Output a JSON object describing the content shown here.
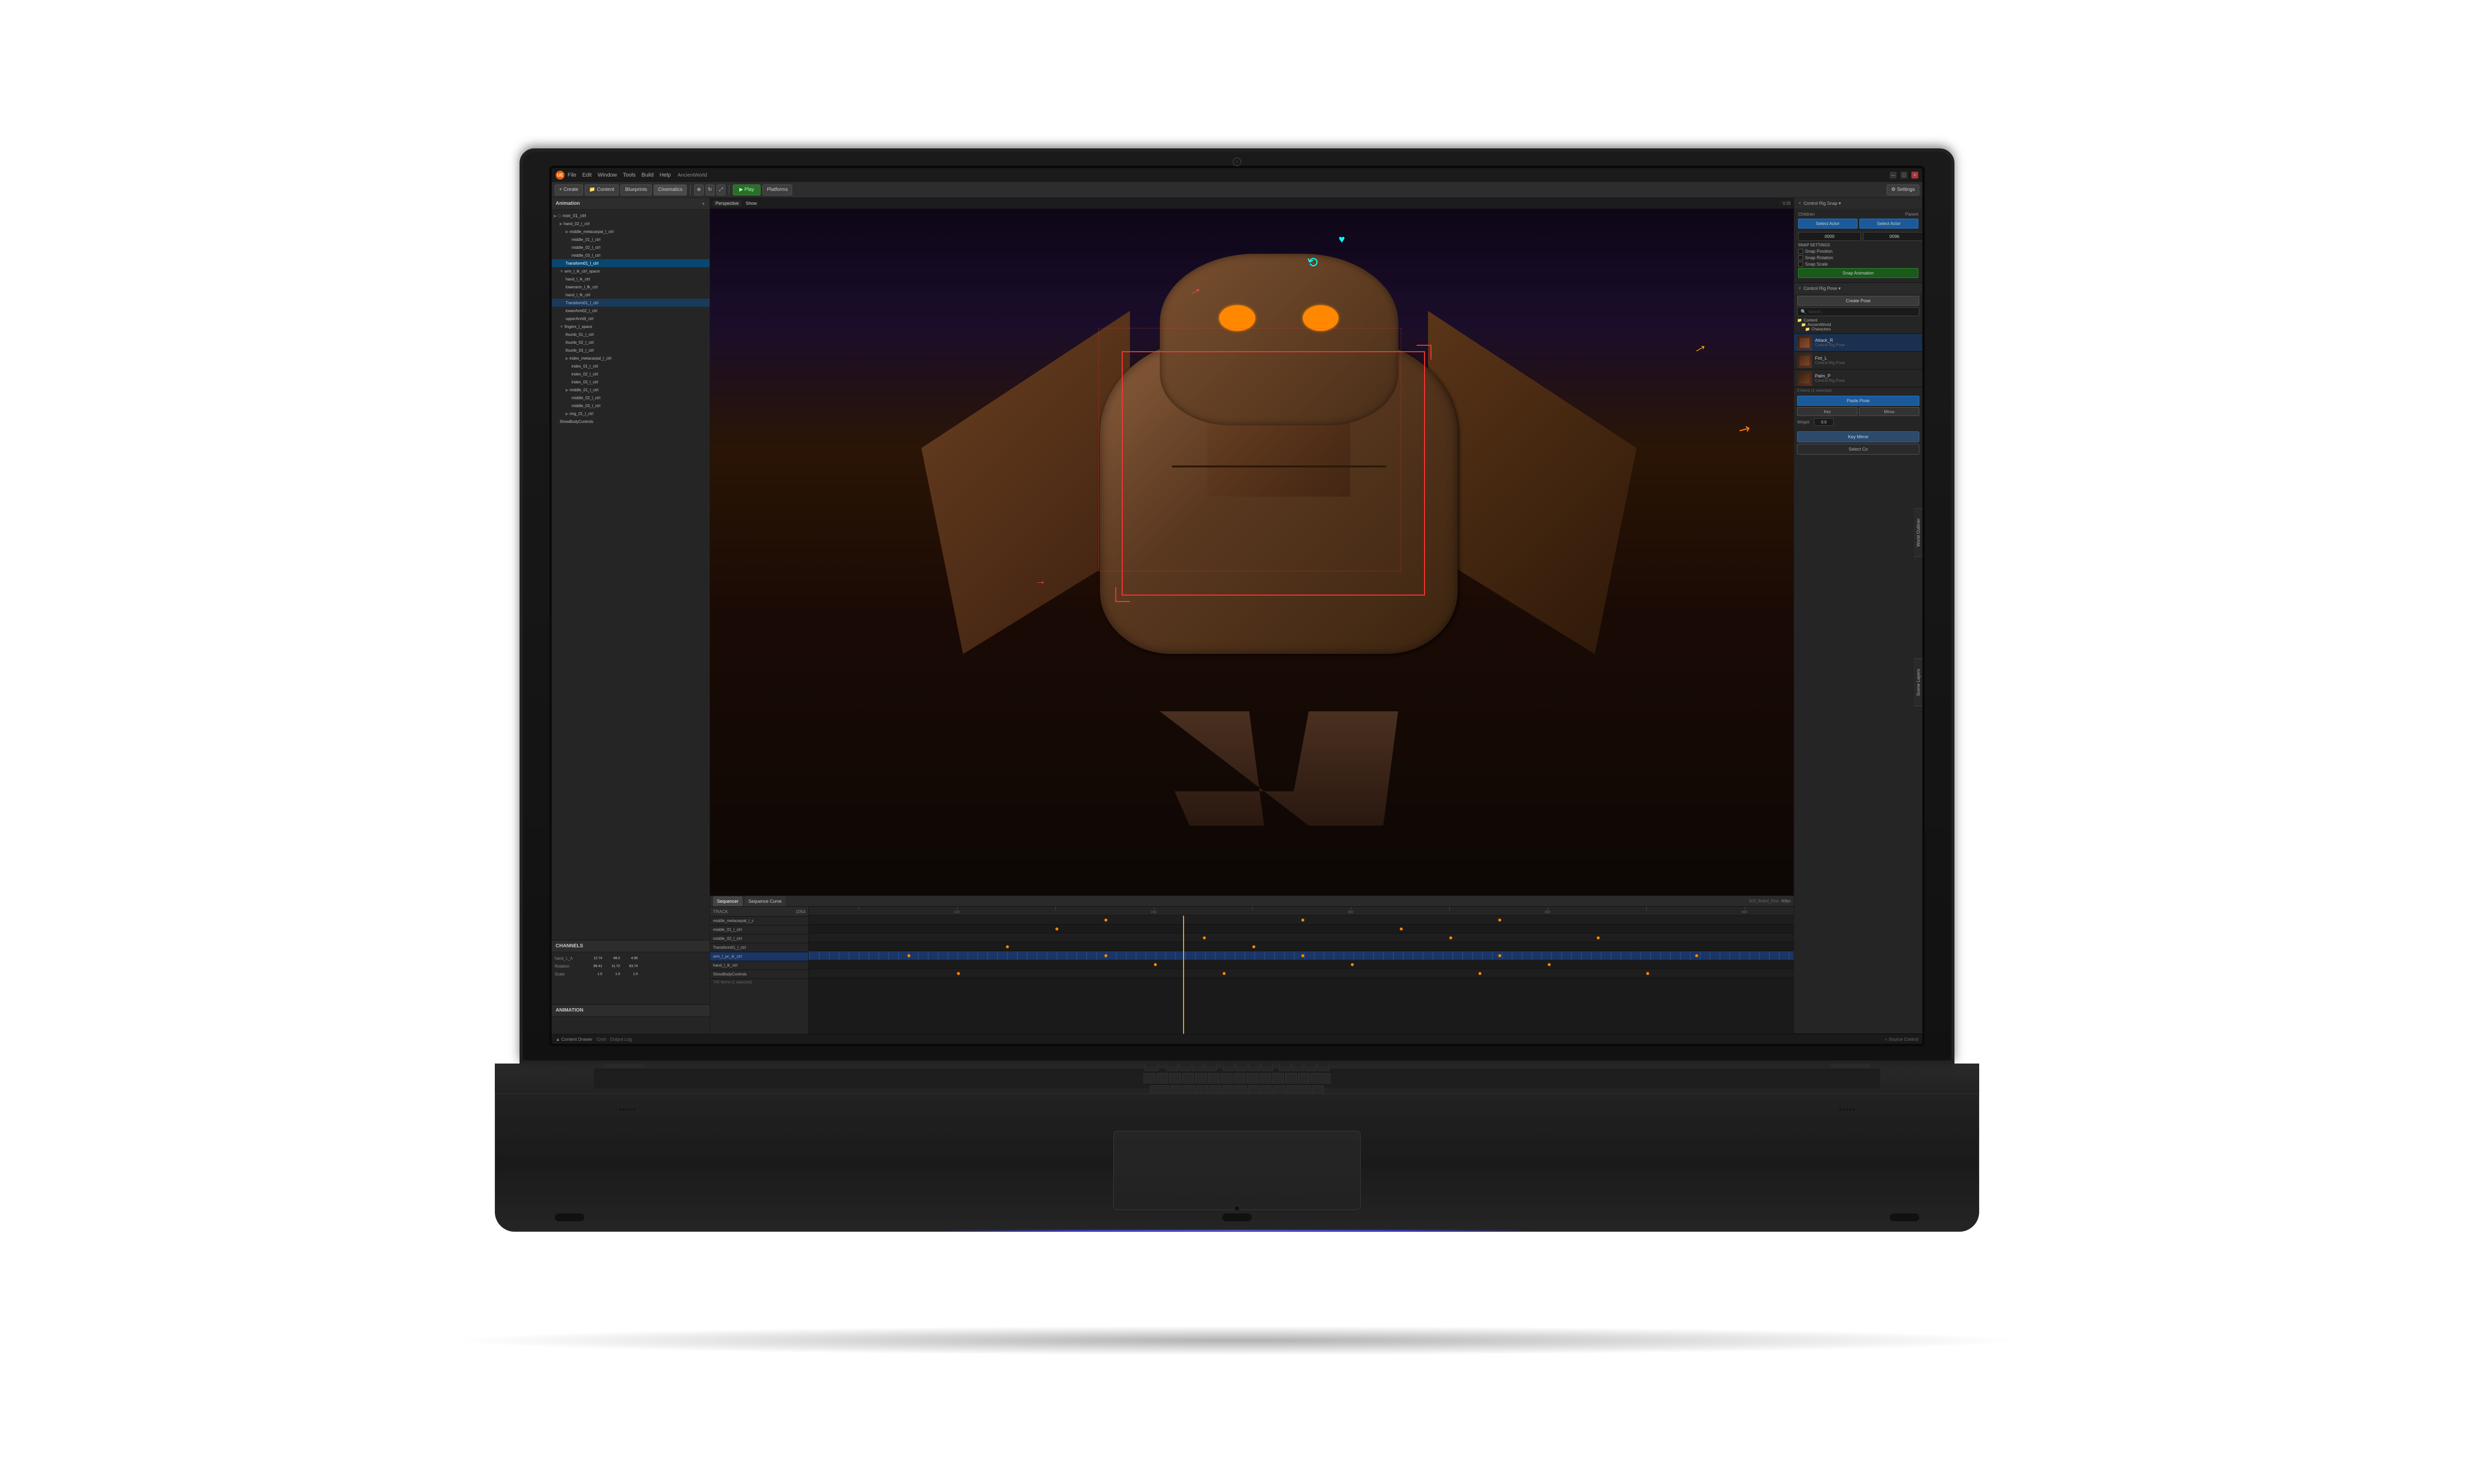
{
  "window": {
    "title": "AncientWorld",
    "logo": "UE",
    "menu": [
      "File",
      "Edit",
      "Window",
      "Tools",
      "Build",
      "Help"
    ],
    "controls": [
      "—",
      "□",
      "✕"
    ]
  },
  "toolbar": {
    "create": "Create",
    "content": "Content",
    "blueprints": "Blueprints",
    "cinematics": "Cinematics",
    "play": "▶ Play",
    "platforms": "Platforms",
    "settings": "⚙ Settings"
  },
  "viewport": {
    "mode": "Perspective",
    "view": "Show",
    "world_label": "World",
    "camera_speed": "0.25"
  },
  "outliner": {
    "title": "Animation",
    "items": [
      "root_01_ctrl",
      "hand_02_l_ctrl",
      "middle_metacarpal_l_ctrl",
      "middle_01_l_ctrl",
      "middle_02_l_ctrl",
      "middle_03_l_ctrl",
      "Transform01_l_ctrl",
      "arm_l_ik_ctrl_space",
      "hand_l_ik_ctrl",
      "lowerarm_l_fk_ctrl",
      "hand_l_fk_ctrl",
      "Transform01_l_ctrl",
      "lowerArm02_l_ctrl",
      "upperArm0l_ctrl",
      "fingers_l_space",
      "thumb_01_l_ctrl",
      "thumb_02_l_ctrl",
      "thumb_03_l_ctrl",
      "index_metacarpal_l_ctrl",
      "index_01_l_ctrl",
      "index_02_l_ctrl",
      "index_03_l_ctrl",
      "middle_01_l_ctrl",
      "middle_02_l_ctrl",
      "middle_03_l_ctrl",
      "ring_01_l_ctrl",
      "ShowBodyControls"
    ]
  },
  "channels": {
    "title": "CHANNELS",
    "items": [
      {
        "name": "hand_L_A",
        "val1": "12.74",
        "val2": "48.0",
        "val3": "4.95"
      },
      {
        "name": "Rotation",
        "val1": "89.41",
        "val2": "11.72",
        "val3": "63.74"
      },
      {
        "name": "Scale",
        "val1": "1.0",
        "val2": "1.0",
        "val3": "1.0"
      }
    ]
  },
  "sequencer": {
    "tabs": [
      "Sequencer",
      "Sequence Curve"
    ],
    "track_header": "TRACK",
    "frame_count": "1054",
    "fps": "30fps",
    "asset": "S02_Robot_Firer",
    "tracks": [
      "middle_metacarpal_l_c",
      "middle_01_l_ctrl",
      "middle_02_l_ctrl",
      "Transform01_l_ctrl",
      "arm_l_pc_ik_ctrl",
      "hand_l_ik_ctrl",
      "ShowBodyControls"
    ],
    "selected_track": "arm_l_pc_ik_ctrl",
    "items_count": "745 Items (1 selected)"
  },
  "control_rig_snap": {
    "title": "Control Rig Snap ▾",
    "child_label": "Children",
    "parent_label": "Parent",
    "child_btn": "Select Actor",
    "parent_btn": "Select Actor",
    "input1": "0000",
    "input2": "0096",
    "snap_settings": "SNAP SETTINGS",
    "snap_pos": "Snap Position",
    "snap_rot": "Snap Rotation",
    "snap_scale": "Snap Scale",
    "snap_btn": "Snap Animation"
  },
  "control_rig_pose": {
    "title": "Control Rig Pose ▾",
    "create_pose": "Create Pose",
    "search_placeholder": "Search...",
    "folders": [
      "Content",
      "AncientWorld",
      "Characters"
    ],
    "poses": [
      {
        "name": "Attack_R",
        "sub": "Control Rig Pose"
      },
      {
        "name": "Fist_L",
        "sub": "Control Rig Pose"
      },
      {
        "name": "Palm_P",
        "sub": "Control Rig Pose"
      }
    ],
    "items_count": "3 Items (1 selected)",
    "paste_pose": "Paste Pose",
    "key_label": "Key",
    "minus_label": "Minus",
    "weight_val": "0.0",
    "key_mirror": "Key Mirror",
    "select_co": "Select Co"
  },
  "world_outliner_tab": "World Outliner",
  "scene_layers_tab": "Scene Layers",
  "status_bar": {
    "content_drawer": "▲ Content Drawer",
    "cmd": "Cmd",
    "output_log": "Output Log",
    "source_control": "⑃ Source Control"
  }
}
